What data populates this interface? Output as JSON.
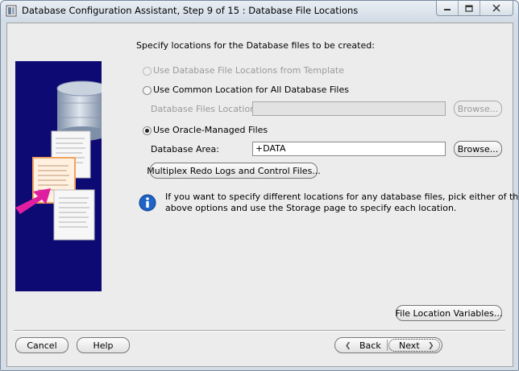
{
  "window": {
    "title": "Database Configuration Assistant, Step 9 of 15 : Database File Locations",
    "minimize_icon": "minimize-icon",
    "maximize_icon": "maximize-icon",
    "close_icon": "close-icon"
  },
  "main": {
    "instruction": "Specify locations for the Database files to be created:",
    "options": [
      {
        "label": "Use Database File Locations from Template",
        "selected": false,
        "enabled": false
      },
      {
        "label": "Use Common Location for All Database Files",
        "selected": false,
        "enabled": true
      },
      {
        "label": "Use Oracle-Managed Files",
        "selected": true,
        "enabled": true
      }
    ],
    "common_location": {
      "label": "Database Files Location:",
      "value": "",
      "browse_label": "Browse..."
    },
    "omf": {
      "label": "Database Area:",
      "value": "+DATA",
      "browse_label": "Browse..."
    },
    "multiplex_button": "Multiplex Redo Logs and Control Files...",
    "info_text_line1": "If you want to specify different locations for any database files, pick either of the",
    "info_text_line2": "above options and use the Storage page to specify each location.",
    "file_location_variables_button": "File Location Variables..."
  },
  "footer": {
    "cancel_label": "Cancel",
    "help_label": "Help",
    "back_label": "Back",
    "next_label": "Next"
  },
  "colors": {
    "side_panel": "#0e0a73",
    "arrow": "#e01ea0",
    "info_icon": "#1e63c8"
  }
}
